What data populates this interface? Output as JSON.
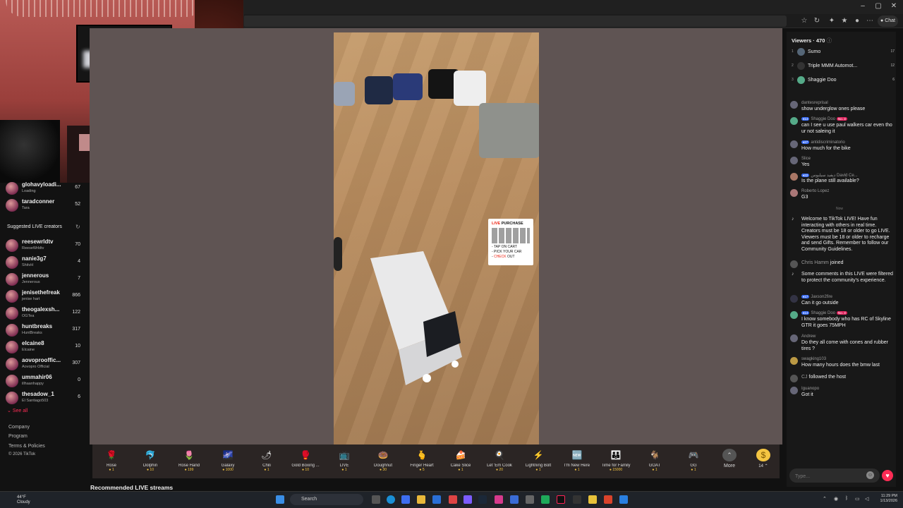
{
  "browser": {
    "chat_label": "Chat"
  },
  "sidebar": {
    "following": [
      {
        "name": "glohavyloadi...",
        "sub": "Loading",
        "count": "67"
      },
      {
        "name": "taradconner",
        "sub": "Tara",
        "count": "52"
      }
    ],
    "suggested_title": "Suggested LIVE creators",
    "suggested": [
      {
        "name": "reesewrldtv",
        "sub": "ReeseWrldtv",
        "count": "70"
      },
      {
        "name": "nanie3g7",
        "sub": "ShitvH",
        "count": "4"
      },
      {
        "name": "jennerous",
        "sub": "Jennerous",
        "count": "7"
      },
      {
        "name": "jenisethefreak",
        "sub": "jenise hart",
        "count": "866"
      },
      {
        "name": "theogalexsh...",
        "sub": "OGTea",
        "count": "122"
      },
      {
        "name": "huntbreaks",
        "sub": "HuntBreaks",
        "count": "317"
      },
      {
        "name": "elcaine8",
        "sub": "Elcaine",
        "count": "10"
      },
      {
        "name": "aovoprooffic...",
        "sub": "Aovopro Official",
        "count": "307"
      },
      {
        "name": "ummahir06",
        "sub": "illhaanhappy",
        "count": "0"
      },
      {
        "name": "thesadow_1",
        "sub": "El Santiago503",
        "count": "6"
      }
    ],
    "see_all": "See all",
    "footer": [
      "Company",
      "Program",
      "Terms & Policies",
      "© 2026 TikTok"
    ]
  },
  "promo": {
    "title_red": "LIVE",
    "title": "PURCHASE",
    "line1": "- TAP ON CART",
    "line2": "- PICK YOUR CAR",
    "line3_prefix": "- ",
    "line3_red": "CHECK",
    "line3_suffix": " OUT"
  },
  "gifts": [
    {
      "name": "Rose",
      "price": "1",
      "icon": "🌹"
    },
    {
      "name": "Dolphin",
      "price": "10",
      "icon": "🐬"
    },
    {
      "name": "Rose Hand",
      "price": "199",
      "icon": "🌷"
    },
    {
      "name": "Galaxy",
      "price": "1000",
      "icon": "🌌"
    },
    {
      "name": "Chili",
      "price": "1",
      "icon": "🌶"
    },
    {
      "name": "Gold Boxing ...",
      "price": "10",
      "icon": "🥊"
    },
    {
      "name": "LIVE",
      "price": "1",
      "icon": "📺"
    },
    {
      "name": "Doughnut",
      "price": "30",
      "icon": "🍩"
    },
    {
      "name": "Finger Heart",
      "price": "5",
      "icon": "🫰"
    },
    {
      "name": "Cake Slice",
      "price": "1",
      "icon": "🍰"
    },
    {
      "name": "Let 'Em Cook",
      "price": "20",
      "icon": "🍳"
    },
    {
      "name": "Lightning Bolt",
      "price": "1",
      "icon": "⚡"
    },
    {
      "name": "I'm New Here",
      "price": "1",
      "icon": "🆕"
    },
    {
      "name": "Time for Family",
      "price": "15000",
      "icon": "👪"
    },
    {
      "name": "GOAT",
      "price": "1",
      "icon": "🐐"
    },
    {
      "name": "GG",
      "price": "1",
      "icon": "🎮"
    }
  ],
  "more_label": "More",
  "coins": "14",
  "recommended": "Recommended LIVE streams",
  "chat": {
    "viewers_label": "Viewers · 470",
    "top": [
      {
        "rank": "1",
        "name": "Sumo",
        "count": "17"
      },
      {
        "rank": "2",
        "name": "Triple MMM Automot...",
        "count": "12"
      },
      {
        "rank": "3",
        "name": "Shaggie Doo",
        "count": "6"
      }
    ],
    "messages": [
      {
        "user": "dantesreprisal",
        "text": "show underglow ones please"
      },
      {
        "user": "Shaggie Doo",
        "lvl": "14",
        "rank": "No. 3",
        "text": "can I see u use paul walkers car even tho ur not saleing it"
      },
      {
        "user": "antidiscriminatorio",
        "lvl": "27",
        "text": "How much for the bike"
      },
      {
        "user": "Slice",
        "text": "Yes"
      },
      {
        "user": "ديفيد سيلبوس David Ce...",
        "lvl": "22",
        "text": "Is the plane still available?"
      },
      {
        "user": "Roberto Lopez",
        "text": "G3"
      }
    ],
    "now": "Now",
    "welcome": "Welcome to TikTok LIVE! Have fun interacting with others in real time. Creators must be 18 or older to go LIVE. Viewers must be 18 or older to recharge and send Gifts. Remember to follow our Community Guidelines.",
    "joined_user": "Chris Hamm",
    "joined_text": "joined",
    "filtered": "Some comments in this LIVE were filtered to protect the community's experience.",
    "messages2": [
      {
        "user": "Jaxson2fire",
        "lvl": "17",
        "text": "Can it go outside"
      },
      {
        "user": "Shaggie Doo",
        "lvl": "14",
        "rank": "No. 3",
        "text": "I know somebody who has RC of Skyline GTR it goes 75MPH"
      },
      {
        "user": "Andrew",
        "text": "Do they all come with cones and rubber tires ?"
      },
      {
        "user": "swagking103",
        "text": "How many hours does the bmw last"
      }
    ],
    "followed_user": "CJ",
    "followed_text": "followed the host",
    "last": {
      "user": "Iguanopo",
      "text": "Got it"
    },
    "input_placeholder": "Type..."
  },
  "taskbar": {
    "temp": "44°F",
    "weather": "Cloudy",
    "search": "Search",
    "time": "11:29 PM",
    "date": "1/13/2026"
  }
}
